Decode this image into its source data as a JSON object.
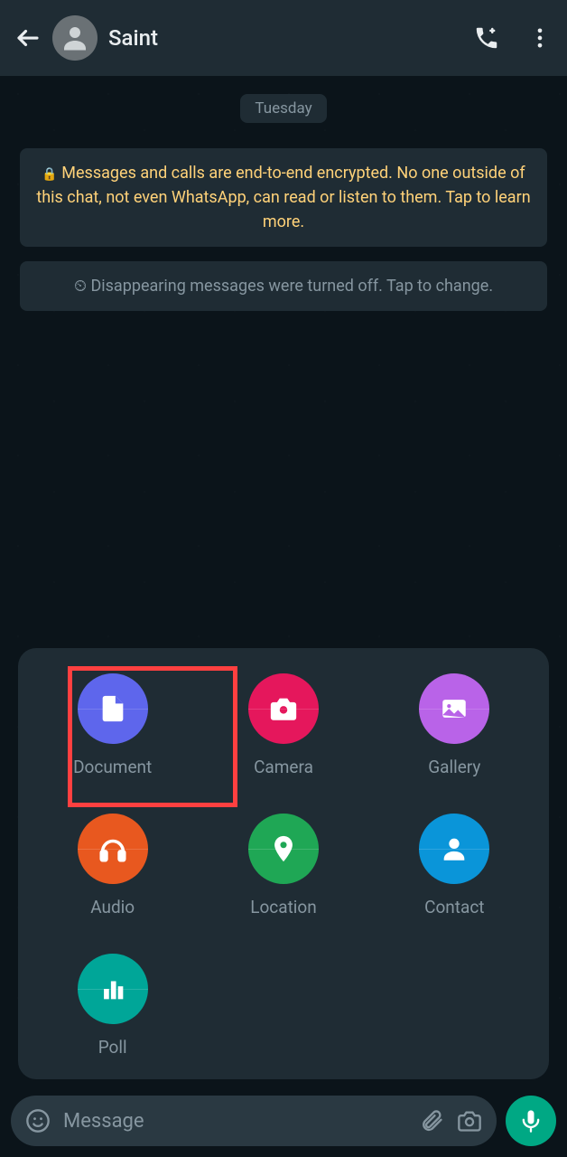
{
  "header": {
    "contact_name": "Saint"
  },
  "chat": {
    "date_label": "Tuesday",
    "encryption_notice": "Messages and calls are end-to-end encrypted. No one outside of this chat, not even WhatsApp, can read or listen to them. Tap to learn more.",
    "disappearing_notice": "Disappearing messages were turned off. Tap to change."
  },
  "attach_panel": {
    "items": [
      {
        "label": "Document",
        "color": "#5e66ec",
        "icon": "document"
      },
      {
        "label": "Camera",
        "color": "#e5175c",
        "icon": "camera"
      },
      {
        "label": "Gallery",
        "color": "#b963e8",
        "icon": "gallery"
      },
      {
        "label": "Audio",
        "color": "#e8581f",
        "icon": "audio"
      },
      {
        "label": "Location",
        "color": "#1fa755",
        "icon": "location"
      },
      {
        "label": "Contact",
        "color": "#0a95d9",
        "icon": "contact"
      },
      {
        "label": "Poll",
        "color": "#00a698",
        "icon": "poll"
      }
    ],
    "highlighted_index": 0
  },
  "input": {
    "placeholder": "Message"
  }
}
